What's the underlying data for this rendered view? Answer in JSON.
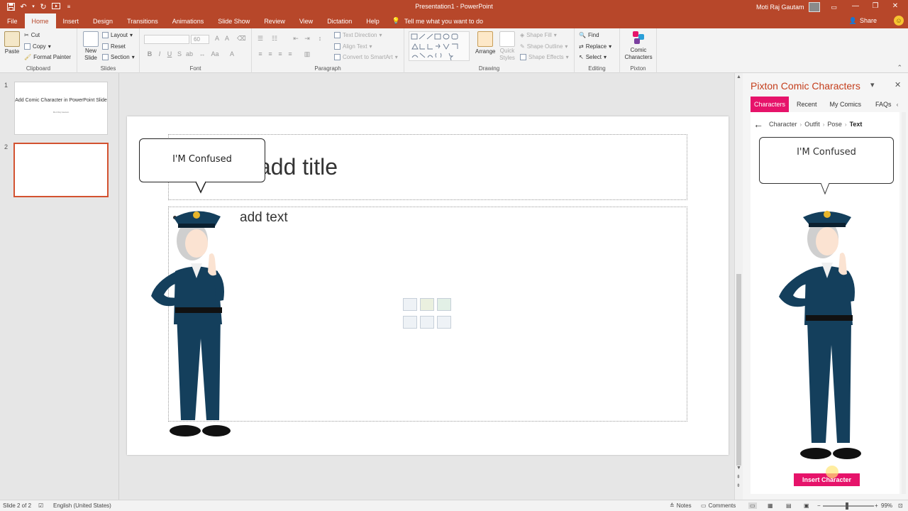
{
  "window": {
    "title": "Presentation1 - PowerPoint",
    "user": "Moti Raj Gautam"
  },
  "tabs": [
    {
      "label": "File"
    },
    {
      "label": "Home"
    },
    {
      "label": "Insert"
    },
    {
      "label": "Design"
    },
    {
      "label": "Transitions"
    },
    {
      "label": "Animations"
    },
    {
      "label": "Slide Show"
    },
    {
      "label": "Review"
    },
    {
      "label": "View"
    },
    {
      "label": "Dictation"
    },
    {
      "label": "Help"
    }
  ],
  "active_tab": "Home",
  "tell_me": "Tell me what you want to do",
  "share_label": "Share",
  "ribbon": {
    "clipboard": {
      "label": "Clipboard",
      "paste": "Paste",
      "cut": "Cut",
      "copy": "Copy",
      "format_painter": "Format Painter"
    },
    "slides": {
      "label": "Slides",
      "new_slide": "New",
      "new_slide2": "Slide",
      "layout": "Layout",
      "reset": "Reset",
      "section": "Section"
    },
    "font": {
      "label": "Font",
      "size": "60"
    },
    "paragraph": {
      "label": "Paragraph",
      "text_direction": "Text Direction",
      "align_text": "Align Text",
      "smartart": "Convert to SmartArt"
    },
    "drawing": {
      "label": "Drawing",
      "arrange": "Arrange",
      "quick_styles": "Quick",
      "quick_styles2": "Styles",
      "shape_fill": "Shape Fill",
      "shape_outline": "Shape Outline",
      "shape_effects": "Shape Effects"
    },
    "editing": {
      "label": "Editing",
      "find": "Find",
      "replace": "Replace",
      "select": "Select"
    },
    "pixton": {
      "label": "Pixton",
      "comic": "Comic",
      "characters": "Characters"
    }
  },
  "thumbnails": [
    {
      "num": "1",
      "title": "Add Comic Character in PowerPoint Slide",
      "sub": "Moti Raj Gautam"
    },
    {
      "num": "2"
    }
  ],
  "slide": {
    "title_placeholder": "add title",
    "body_placeholder": "add text",
    "bubble_text": "I'M Confused"
  },
  "pane": {
    "title": "Pixton Comic Characters",
    "tabs": [
      {
        "label": "Characters"
      },
      {
        "label": "Recent"
      },
      {
        "label": "My Comics"
      },
      {
        "label": "FAQs"
      }
    ],
    "breadcrumb": [
      "Character",
      "Outfit",
      "Pose",
      "Text"
    ],
    "bubble_text": "I'M Confused",
    "insert_button": "Insert Character"
  },
  "status": {
    "slide_info": "Slide 2 of 2",
    "language": "English (United States)",
    "notes": "Notes",
    "comments": "Comments",
    "zoom": "99%"
  },
  "colors": {
    "accent": "#b7472a",
    "pixton_pink": "#e6136a",
    "uniform": "#143f5c"
  }
}
